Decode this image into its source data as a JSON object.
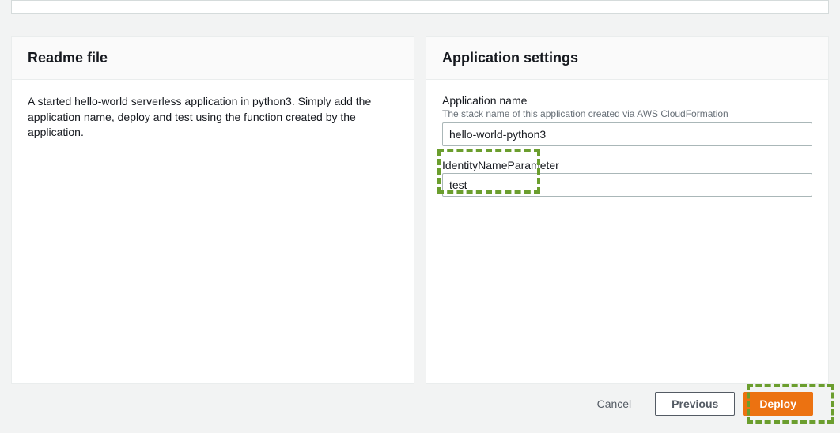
{
  "readme_panel": {
    "title": "Readme file",
    "body": "A started hello-world serverless application in python3. Simply add the application name, deploy and test using the function created by the application."
  },
  "settings_panel": {
    "title": "Application settings",
    "app_name": {
      "label": "Application name",
      "hint": "The stack name of this application created via AWS CloudFormation",
      "value": "hello-world-python3"
    },
    "identity_param": {
      "label": "IdentityNameParameter",
      "value": "test"
    }
  },
  "footer": {
    "cancel": "Cancel",
    "previous": "Previous",
    "deploy": "Deploy"
  }
}
